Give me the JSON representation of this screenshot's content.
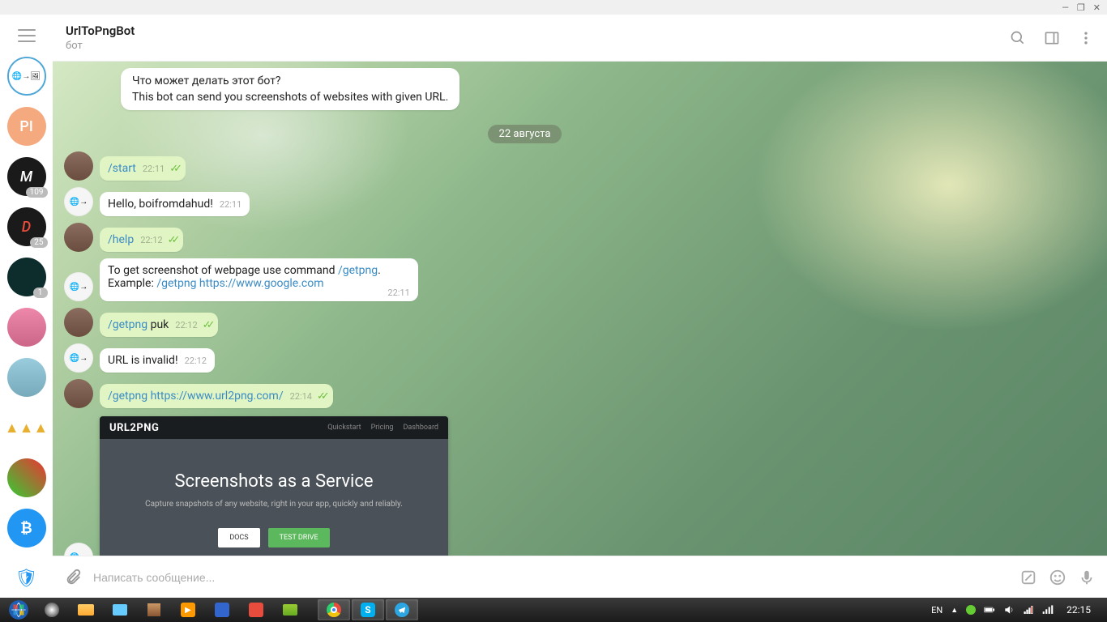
{
  "window": {
    "minimize": "—",
    "maximize": "❐",
    "close": "✕"
  },
  "header": {
    "title": "UrlToPngBot",
    "subtitle": "бот"
  },
  "sidebar": {
    "items": [
      {
        "type": "bot",
        "active": true
      },
      {
        "type": "initials",
        "label": "PI",
        "bg": "#f5a97f"
      },
      {
        "type": "dark",
        "label": "M",
        "badge": "109"
      },
      {
        "type": "dark",
        "label": "D",
        "badge": "25"
      },
      {
        "type": "dark-green",
        "badge": "1"
      },
      {
        "type": "photo-pink"
      },
      {
        "type": "photo-blue"
      },
      {
        "type": "gold"
      },
      {
        "type": "comic"
      },
      {
        "type": "bitcoin"
      },
      {
        "type": "shield"
      }
    ]
  },
  "chat": {
    "info_title": "Что может делать этот бот?",
    "info_desc": "This bot can send you screenshots of websites with given URL.",
    "date": "22 августа",
    "messages": [
      {
        "who": "me",
        "text": "/start",
        "time": "22:11",
        "cmd": true,
        "checks": true
      },
      {
        "who": "bot",
        "text": "Hello, boifromdahud!",
        "time": "22:11"
      },
      {
        "who": "me",
        "text": "/help",
        "time": "22:12",
        "cmd": true,
        "checks": true
      },
      {
        "who": "bot",
        "multiline": true,
        "line1_pre": "To get screenshot of webpage use command ",
        "line1_cmd": "/getpng",
        "line1_post": ".",
        "line2_pre": "Example: ",
        "line2_cmd": "/getpng https://www.google.com",
        "time": "22:11"
      },
      {
        "who": "me",
        "cmd_part": "/getpng",
        "text_part": " puk",
        "time": "22:12",
        "checks": true
      },
      {
        "who": "bot",
        "text": "URL is invalid!",
        "time": "22:12"
      },
      {
        "who": "me",
        "cmd_full": "/getpng https://www.url2png.com/",
        "time": "22:14",
        "checks": true
      }
    ]
  },
  "screenshot": {
    "brand": "URL2PNG",
    "nav": [
      "Quickstart",
      "Pricing",
      "Dashboard"
    ],
    "headline": "Screenshots as a Service",
    "sub": "Capture snapshots of any website, right in your app, quickly and reliably.",
    "btn_docs": "DOCS",
    "btn_test": "TEST DRIVE"
  },
  "input": {
    "placeholder": "Написать сообщение..."
  },
  "taskbar": {
    "lang": "EN",
    "clock": "22:15"
  }
}
